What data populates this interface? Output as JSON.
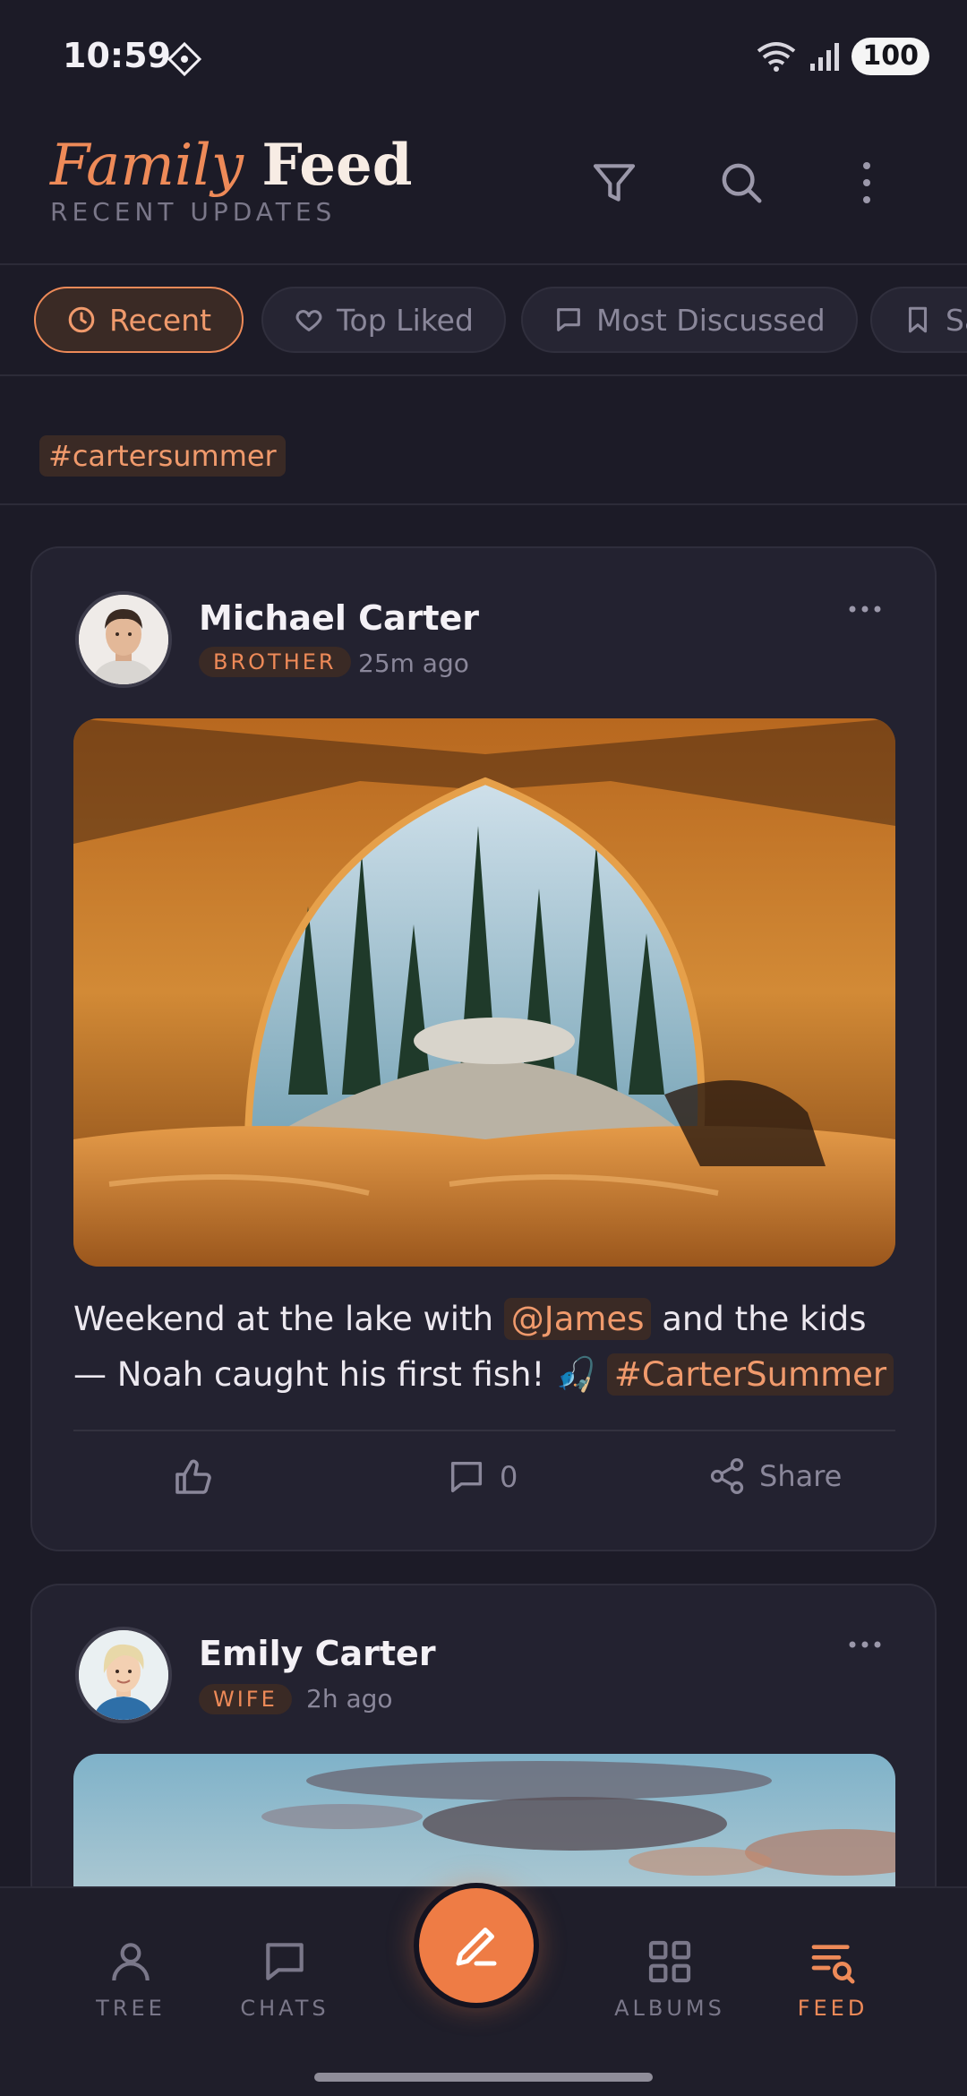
{
  "status_bar": {
    "time": "10:59",
    "battery": "100"
  },
  "header": {
    "title_part1": "Family",
    "title_part2": "Feed",
    "subtitle": "RECENT UPDATES"
  },
  "filters": [
    {
      "label": "Recent",
      "icon": "clock-icon",
      "active": true
    },
    {
      "label": "Top Liked",
      "icon": "heart-icon",
      "active": false
    },
    {
      "label": "Most Discussed",
      "icon": "comment-icon",
      "active": false
    },
    {
      "label": "Sa",
      "icon": "bookmark-icon",
      "active": false
    }
  ],
  "active_tag": "#cartersummer",
  "posts": [
    {
      "author": "Michael Carter",
      "relation": "BROTHER",
      "time": "25m ago",
      "photo": "tent-lake-view-photo",
      "text_a": "Weekend at the lake with ",
      "mention": "@James",
      "text_b": " and the kids — Noah caught his first fish! 🎣 ",
      "hashtag": "#CarterSummer",
      "comments": "0",
      "share_label": "Share"
    },
    {
      "author": "Emily Carter",
      "relation": "WIFE",
      "time": "2h ago",
      "photo": "sunset-sky-photo"
    }
  ],
  "nav": [
    {
      "label": "TREE",
      "icon": "person-icon"
    },
    {
      "label": "CHATS",
      "icon": "chat-icon"
    },
    {
      "label": "ALBUMS",
      "icon": "grid-icon"
    },
    {
      "label": "FEED",
      "icon": "feed-search-icon",
      "active": true
    }
  ],
  "colors": {
    "background": "#1c1b27",
    "card": "#232230",
    "accent": "#ee8a58",
    "muted": "#8a879a"
  }
}
